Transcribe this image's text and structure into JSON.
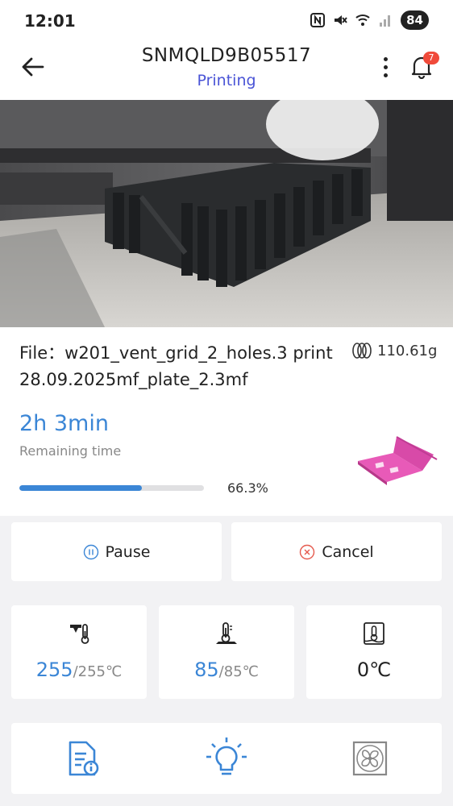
{
  "status_bar": {
    "time": "12:01",
    "battery": "84"
  },
  "header": {
    "title": "SNMQLD9B05517",
    "status": "Printing",
    "notification_count": "7"
  },
  "file": {
    "label": "File：w201_vent_grid_2_holes.3 print 28.09.2025mf_plate_2.3mf",
    "weight": "110.61g"
  },
  "progress": {
    "remaining": "2h 3min",
    "remaining_label": "Remaining time",
    "percent_text": "66.3%",
    "fraction": 0.663
  },
  "controls": {
    "pause_label": "Pause",
    "cancel_label": "Cancel"
  },
  "temps": {
    "nozzle_current": "255",
    "nozzle_target": "/255℃",
    "bed_current": "85",
    "bed_target": "/85℃",
    "chamber": "0℃"
  },
  "icons": {
    "back": "back-arrow-icon",
    "more": "more-vertical-icon",
    "bell": "bell-icon",
    "filament": "filament-spool-icon",
    "pause": "pause-circle-icon",
    "cancel": "cancel-circle-icon",
    "nozzle": "nozzle-temperature-icon",
    "bed": "bed-temperature-icon",
    "chamber": "chamber-temperature-icon",
    "file_info": "file-info-icon",
    "light": "light-bulb-icon",
    "fan": "fan-icon"
  },
  "colors": {
    "accent": "#3b86d6",
    "status": "#4a54d6",
    "badge": "#f04a3a",
    "cancel": "#e55a4e",
    "model": "#e85ab8"
  }
}
